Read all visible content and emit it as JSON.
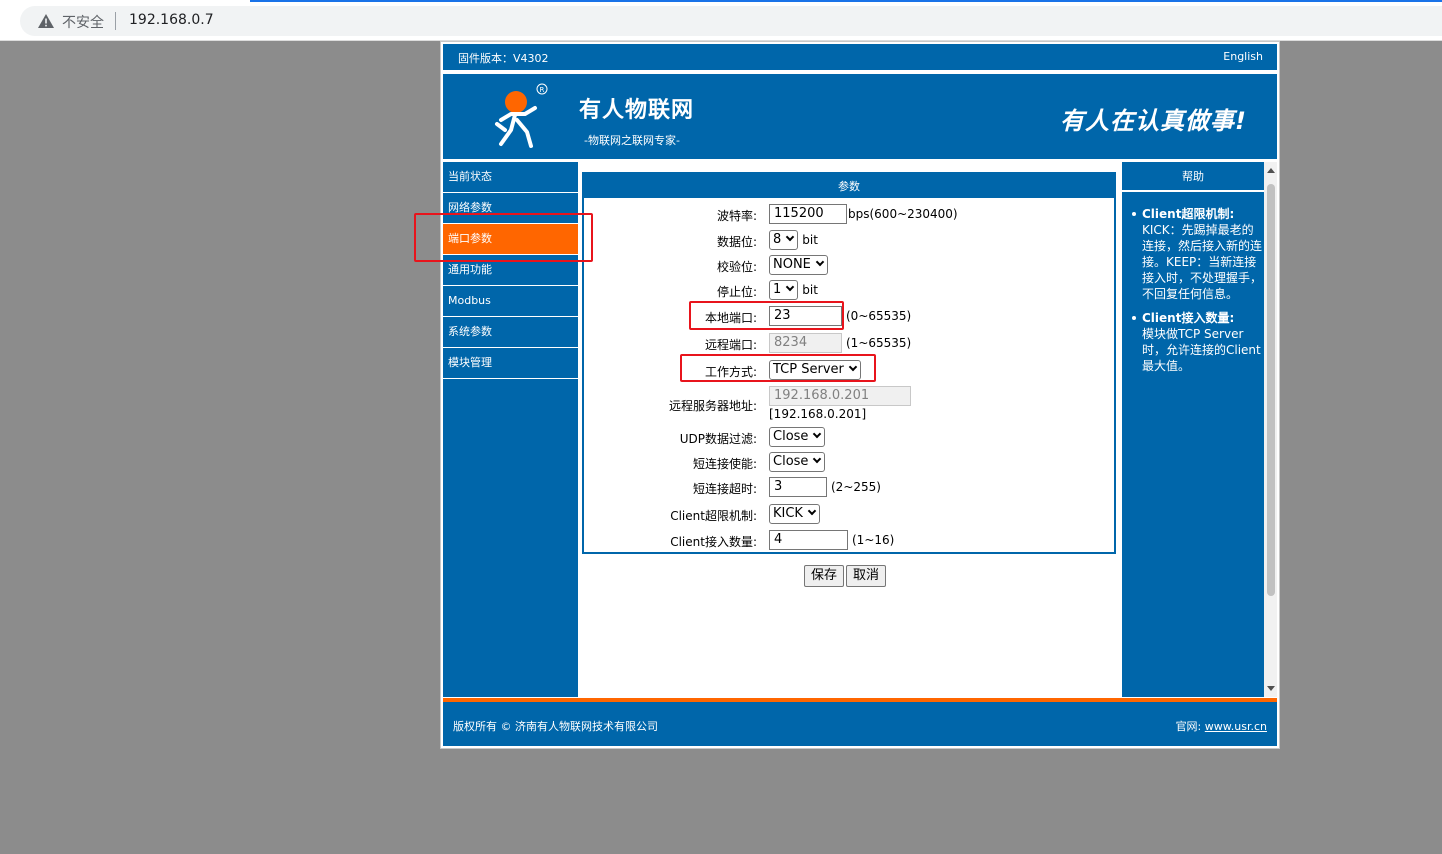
{
  "browser": {
    "security_label": "不安全",
    "url": "192.168.0.7"
  },
  "header": {
    "firmware": "固件版本：V4302",
    "language": "English",
    "brand": "有人物联网",
    "subbrand": "-物联网之联网专家-",
    "slogan": "有人在认真做事!"
  },
  "sidebar": {
    "items": [
      {
        "label": "当前状态"
      },
      {
        "label": "网络参数"
      },
      {
        "label": "端口参数"
      },
      {
        "label": "通用功能"
      },
      {
        "label": "Modbus"
      },
      {
        "label": "系统参数"
      },
      {
        "label": "模块管理"
      }
    ],
    "active_index": 2
  },
  "params": {
    "title": "参数",
    "baud": {
      "label": "波特率:",
      "value": "115200",
      "hint": "bps(600~230400)"
    },
    "databits": {
      "label": "数据位:",
      "value": "8",
      "hint": "bit"
    },
    "parity": {
      "label": "校验位:",
      "value": "NONE"
    },
    "stopbits": {
      "label": "停止位:",
      "value": "1",
      "hint": "bit"
    },
    "local_port": {
      "label": "本地端口:",
      "value": "23",
      "hint": "(0~65535)"
    },
    "remote_port": {
      "label": "远程端口:",
      "value": "8234",
      "hint": "(1~65535)"
    },
    "work_mode": {
      "label": "工作方式:",
      "value": "TCP Server"
    },
    "remote_addr": {
      "label": "远程服务器地址:",
      "value": "192.168.0.201",
      "resolved": "[192.168.0.201]"
    },
    "udp_filter": {
      "label": "UDP数据过滤:",
      "value": "Close"
    },
    "short_conn": {
      "label": "短连接使能:",
      "value": "Close"
    },
    "short_timeout": {
      "label": "短连接超时:",
      "value": "3",
      "hint": "(2~255)"
    },
    "client_limit": {
      "label": "Client超限机制:",
      "value": "KICK"
    },
    "client_count": {
      "label": "Client接入数量:",
      "value": "4",
      "hint": "(1~16)"
    }
  },
  "buttons": {
    "save": "保存",
    "cancel": "取消"
  },
  "help": {
    "title": "帮助",
    "items": [
      {
        "title": "Client超限机制:",
        "body": "KICK：先踢掉最老的连接，然后接入新的连接。KEEP：当新连接接入时，不处理握手，不回复任何信息。"
      },
      {
        "title": "Client接入数量:",
        "body": "模块做TCP Server时，允许连接的Client最大值。"
      }
    ]
  },
  "footer": {
    "copyright": "版权所有 © 济南有人物联网技术有限公司",
    "site_label": "官网:",
    "site_link": "www.usr.cn"
  },
  "colors": {
    "primary": "#0066aa",
    "accent": "#ff6600",
    "highlight": "#e8141c"
  }
}
